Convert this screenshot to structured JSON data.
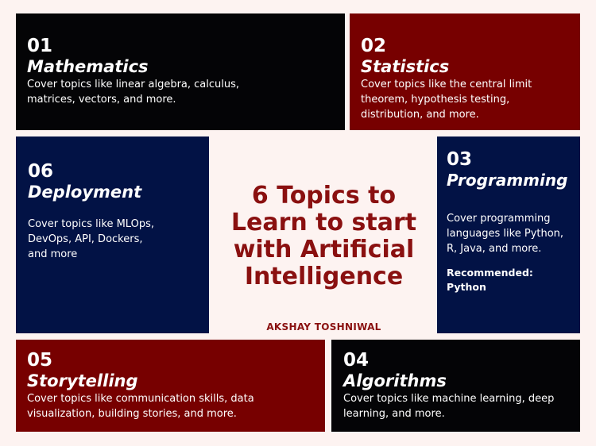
{
  "heading": "6 Topics to Learn to start with Artificial Intelligence",
  "author": "AKSHAY TOSHNIWAL",
  "colors": {
    "background": "#fdf3f1",
    "black_card": "#040406",
    "red_card": "#770000",
    "navy_card": "#021245",
    "heading_text": "#8a1010"
  },
  "topics": {
    "mathematics": {
      "number": "01",
      "title": "Mathematics",
      "description": "Cover topics like linear algebra, calculus, matrices, vectors, and more."
    },
    "statistics": {
      "number": "02",
      "title": "Statistics",
      "description": "Cover topics like the central limit theorem, hypothesis testing, distribution, and more."
    },
    "programming": {
      "number": "03",
      "title": "Programming",
      "description": "Cover programming languages like Python, R, Java, and more.",
      "recommendation": "Recommended: Python"
    },
    "algorithms": {
      "number": "04",
      "title": "Algorithms",
      "description": "Cover topics like machine learning, deep learning, and more."
    },
    "storytelling": {
      "number": "05",
      "title": "Storytelling",
      "description": "Cover topics like communication skills, data visualization, building stories, and more."
    },
    "deployment": {
      "number": "06",
      "title": "Deployment",
      "description": "Cover topics like MLOps, DevOps, API, Dockers, and more"
    }
  }
}
